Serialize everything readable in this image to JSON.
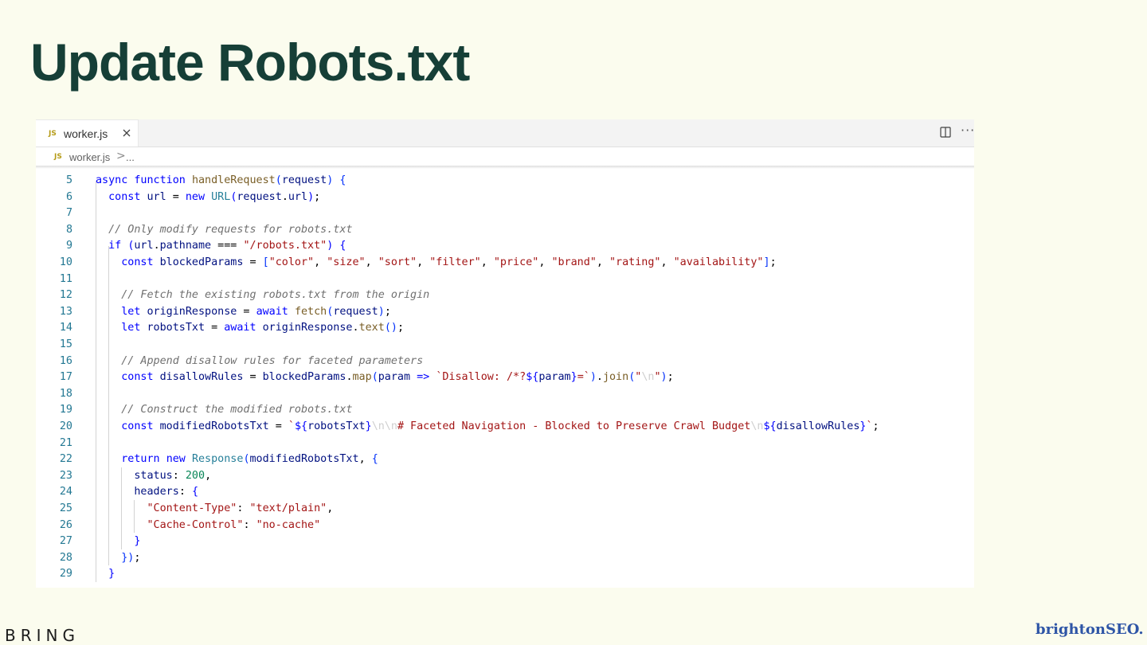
{
  "slide": {
    "title": "Update Robots.txt",
    "footer_left": "BRING",
    "footer_right": "brightonSEO."
  },
  "editor": {
    "tab": {
      "badge": "JS",
      "label": "worker.js",
      "close_icon": "close-icon"
    },
    "actions": {
      "split_icon": "split-editor-icon",
      "more": "···"
    },
    "breadcrumb": {
      "badge": "JS",
      "file": "worker.js",
      "separator": ">",
      "more": "..."
    },
    "colors": {
      "keyword": "#0000ff",
      "function": "#795e26",
      "type": "#267f99",
      "string": "#a31515",
      "variable": "#001080",
      "number": "#098658",
      "comment": "#707070",
      "line_number": "#237893"
    },
    "lines": [
      {
        "n": "5",
        "tokens": [
          [
            "k",
            "async"
          ],
          [
            "d",
            " "
          ],
          [
            "k",
            "function"
          ],
          [
            "d",
            " "
          ],
          [
            "f",
            "handleRequest"
          ],
          [
            "p",
            "("
          ],
          [
            "v",
            "request"
          ],
          [
            "p",
            ")"
          ],
          [
            "d",
            " "
          ],
          [
            "p",
            "{"
          ]
        ]
      },
      {
        "n": "6",
        "tokens": [
          [
            "d",
            "  "
          ],
          [
            "k",
            "const"
          ],
          [
            "d",
            " "
          ],
          [
            "v",
            "url"
          ],
          [
            "o",
            " = "
          ],
          [
            "k",
            "new"
          ],
          [
            "d",
            " "
          ],
          [
            "t",
            "URL"
          ],
          [
            "e",
            "("
          ],
          [
            "v",
            "request"
          ],
          [
            "o",
            "."
          ],
          [
            "v",
            "url"
          ],
          [
            "e",
            ")"
          ],
          [
            "o",
            ";"
          ]
        ]
      },
      {
        "n": "7",
        "tokens": []
      },
      {
        "n": "8",
        "tokens": [
          [
            "d",
            "  "
          ],
          [
            "cm",
            "// Only modify requests for robots.txt"
          ]
        ]
      },
      {
        "n": "9",
        "tokens": [
          [
            "d",
            "  "
          ],
          [
            "k",
            "if"
          ],
          [
            "d",
            " "
          ],
          [
            "e",
            "("
          ],
          [
            "v",
            "url"
          ],
          [
            "o",
            "."
          ],
          [
            "v",
            "pathname"
          ],
          [
            "o",
            " === "
          ],
          [
            "s",
            "\"/robots.txt\""
          ],
          [
            "e",
            ")"
          ],
          [
            "d",
            " "
          ],
          [
            "e",
            "{"
          ]
        ]
      },
      {
        "n": "10",
        "tokens": [
          [
            "d",
            "    "
          ],
          [
            "k",
            "const"
          ],
          [
            "d",
            " "
          ],
          [
            "v",
            "blockedParams"
          ],
          [
            "o",
            " = "
          ],
          [
            "p",
            "["
          ],
          [
            "s",
            "\"color\""
          ],
          [
            "o",
            ", "
          ],
          [
            "s",
            "\"size\""
          ],
          [
            "o",
            ", "
          ],
          [
            "s",
            "\"sort\""
          ],
          [
            "o",
            ", "
          ],
          [
            "s",
            "\"filter\""
          ],
          [
            "o",
            ", "
          ],
          [
            "s",
            "\"price\""
          ],
          [
            "o",
            ", "
          ],
          [
            "s",
            "\"brand\""
          ],
          [
            "o",
            ", "
          ],
          [
            "s",
            "\"rating\""
          ],
          [
            "o",
            ", "
          ],
          [
            "s",
            "\"availability\""
          ],
          [
            "p",
            "]"
          ],
          [
            "o",
            ";"
          ]
        ]
      },
      {
        "n": "11",
        "tokens": []
      },
      {
        "n": "12",
        "tokens": [
          [
            "d",
            "    "
          ],
          [
            "cm",
            "// Fetch the existing robots.txt from the origin"
          ]
        ]
      },
      {
        "n": "13",
        "tokens": [
          [
            "d",
            "    "
          ],
          [
            "k",
            "let"
          ],
          [
            "d",
            " "
          ],
          [
            "v",
            "originResponse"
          ],
          [
            "o",
            " = "
          ],
          [
            "k",
            "await"
          ],
          [
            "d",
            " "
          ],
          [
            "f",
            "fetch"
          ],
          [
            "p",
            "("
          ],
          [
            "v",
            "request"
          ],
          [
            "p",
            ")"
          ],
          [
            "o",
            ";"
          ]
        ]
      },
      {
        "n": "14",
        "tokens": [
          [
            "d",
            "    "
          ],
          [
            "k",
            "let"
          ],
          [
            "d",
            " "
          ],
          [
            "v",
            "robotsTxt"
          ],
          [
            "o",
            " = "
          ],
          [
            "k",
            "await"
          ],
          [
            "d",
            " "
          ],
          [
            "v",
            "originResponse"
          ],
          [
            "o",
            "."
          ],
          [
            "f",
            "text"
          ],
          [
            "p",
            "()"
          ],
          [
            "o",
            ";"
          ]
        ]
      },
      {
        "n": "15",
        "tokens": []
      },
      {
        "n": "16",
        "tokens": [
          [
            "d",
            "    "
          ],
          [
            "cm",
            "// Append disallow rules for faceted parameters"
          ]
        ]
      },
      {
        "n": "17",
        "tokens": [
          [
            "d",
            "    "
          ],
          [
            "k",
            "const"
          ],
          [
            "d",
            " "
          ],
          [
            "v",
            "disallowRules"
          ],
          [
            "o",
            " = "
          ],
          [
            "v",
            "blockedParams"
          ],
          [
            "o",
            "."
          ],
          [
            "f",
            "map"
          ],
          [
            "p",
            "("
          ],
          [
            "v",
            "param"
          ],
          [
            "d",
            " "
          ],
          [
            "k",
            "=>"
          ],
          [
            "d",
            " "
          ],
          [
            "s",
            "`Disallow: /*?"
          ],
          [
            "k",
            "${"
          ],
          [
            "v",
            "param"
          ],
          [
            "k",
            "}"
          ],
          [
            "s",
            "=`"
          ],
          [
            "p",
            ")"
          ],
          [
            "o",
            "."
          ],
          [
            "f",
            "join"
          ],
          [
            "p",
            "("
          ],
          [
            "s",
            "\""
          ],
          [
            "esc",
            "\\n"
          ],
          [
            "s",
            "\""
          ],
          [
            "p",
            ")"
          ],
          [
            "o",
            ";"
          ]
        ]
      },
      {
        "n": "18",
        "tokens": []
      },
      {
        "n": "19",
        "tokens": [
          [
            "d",
            "    "
          ],
          [
            "cm",
            "// Construct the modified robots.txt"
          ]
        ]
      },
      {
        "n": "20",
        "tokens": [
          [
            "d",
            "    "
          ],
          [
            "k",
            "const"
          ],
          [
            "d",
            " "
          ],
          [
            "v",
            "modifiedRobotsTxt"
          ],
          [
            "o",
            " = "
          ],
          [
            "s",
            "`"
          ],
          [
            "k",
            "${"
          ],
          [
            "v",
            "robotsTxt"
          ],
          [
            "k",
            "}"
          ],
          [
            "esc",
            "\\n\\n"
          ],
          [
            "s",
            "# Faceted Navigation - Blocked to Preserve Crawl Budget"
          ],
          [
            "esc",
            "\\n"
          ],
          [
            "k",
            "${"
          ],
          [
            "v",
            "disallowRules"
          ],
          [
            "k",
            "}"
          ],
          [
            "s",
            "`"
          ],
          [
            "o",
            ";"
          ]
        ]
      },
      {
        "n": "21",
        "tokens": []
      },
      {
        "n": "22",
        "tokens": [
          [
            "d",
            "    "
          ],
          [
            "k",
            "return"
          ],
          [
            "d",
            " "
          ],
          [
            "k",
            "new"
          ],
          [
            "d",
            " "
          ],
          [
            "t",
            "Response"
          ],
          [
            "p",
            "("
          ],
          [
            "v",
            "modifiedRobotsTxt"
          ],
          [
            "o",
            ", "
          ],
          [
            "p",
            "{"
          ]
        ]
      },
      {
        "n": "23",
        "tokens": [
          [
            "d",
            "      "
          ],
          [
            "v",
            "status"
          ],
          [
            "o",
            ": "
          ],
          [
            "n",
            "200"
          ],
          [
            "o",
            ","
          ]
        ]
      },
      {
        "n": "24",
        "tokens": [
          [
            "d",
            "      "
          ],
          [
            "v",
            "headers"
          ],
          [
            "o",
            ": "
          ],
          [
            "e",
            "{"
          ]
        ]
      },
      {
        "n": "25",
        "tokens": [
          [
            "d",
            "        "
          ],
          [
            "s",
            "\"Content-Type\""
          ],
          [
            "o",
            ": "
          ],
          [
            "s",
            "\"text/plain\""
          ],
          [
            "o",
            ","
          ]
        ]
      },
      {
        "n": "26",
        "tokens": [
          [
            "d",
            "        "
          ],
          [
            "s",
            "\"Cache-Control\""
          ],
          [
            "o",
            ": "
          ],
          [
            "s",
            "\"no-cache\""
          ]
        ]
      },
      {
        "n": "27",
        "tokens": [
          [
            "d",
            "      "
          ],
          [
            "e",
            "}"
          ]
        ]
      },
      {
        "n": "28",
        "tokens": [
          [
            "d",
            "    "
          ],
          [
            "p",
            "})"
          ],
          [
            "o",
            ";"
          ]
        ]
      },
      {
        "n": "29",
        "tokens": [
          [
            "d",
            "  "
          ],
          [
            "e",
            "}"
          ]
        ]
      }
    ]
  }
}
